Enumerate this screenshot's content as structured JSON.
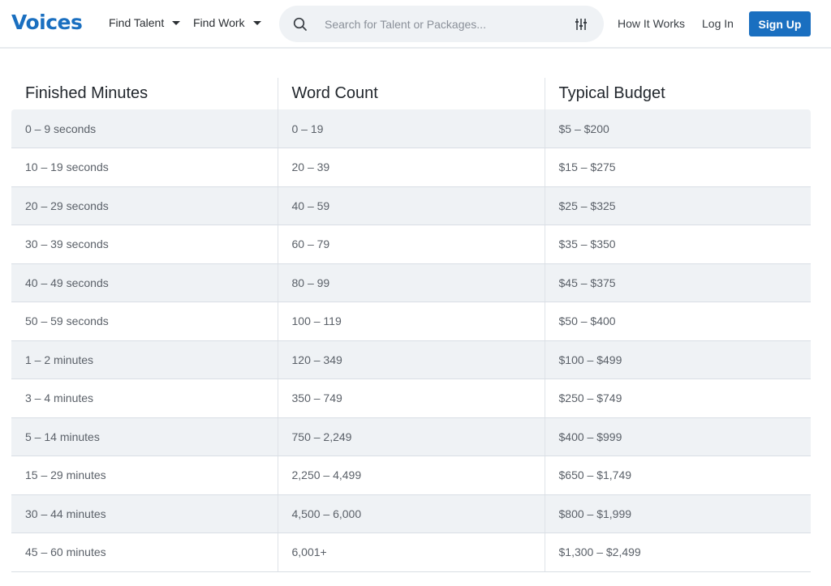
{
  "header": {
    "logo": "Voices",
    "nav": {
      "find_talent": "Find Talent",
      "find_work": "Find Work",
      "how_it_works": "How It Works",
      "log_in": "Log In",
      "sign_up": "Sign Up"
    },
    "search": {
      "placeholder": "Search for Talent or Packages...",
      "value": "",
      "icon": "search-icon",
      "filter_icon": "sliders-icon"
    }
  },
  "colors": {
    "brand": "#1a6fc0",
    "row_stripe": "#eff2f5",
    "search_bg": "#eff2f5"
  },
  "table": {
    "columns": [
      "Finished Minutes",
      "Word Count",
      "Typical Budget"
    ],
    "rows": [
      [
        "0 – 9 seconds",
        "0 – 19",
        "$5 – $200"
      ],
      [
        "10 – 19 seconds",
        "20 – 39",
        "$15 – $275"
      ],
      [
        "20 – 29 seconds",
        "40 – 59",
        "$25 – $325"
      ],
      [
        "30 – 39 seconds",
        "60 – 79",
        "$35 – $350"
      ],
      [
        "40 – 49 seconds",
        "80 – 99",
        "$45 – $375"
      ],
      [
        "50 – 59 seconds",
        "100 – 119",
        "$50 – $400"
      ],
      [
        "1 – 2 minutes",
        "120 – 349",
        "$100 – $499"
      ],
      [
        "3 – 4 minutes",
        "350 – 749",
        "$250 – $749"
      ],
      [
        "5 – 14 minutes",
        "750 – 2,249",
        "$400 – $999"
      ],
      [
        "15 – 29 minutes",
        "2,250 – 4,499",
        "$650 – $1,749"
      ],
      [
        "30 – 44 minutes",
        "4,500 – 6,000",
        "$800 – $1,999"
      ],
      [
        "45 – 60 minutes",
        "6,001+",
        "$1,300 – $2,499"
      ]
    ]
  }
}
